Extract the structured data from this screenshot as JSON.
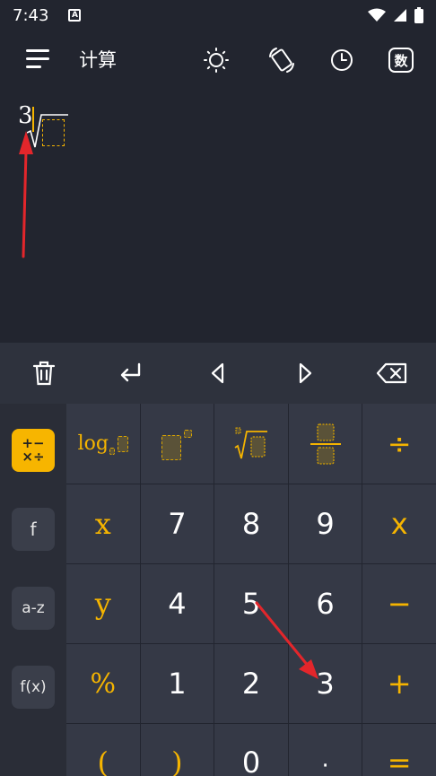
{
  "status_bar": {
    "time": "7:43",
    "notification_icon": "a-notification-icon"
  },
  "app_bar": {
    "title": "计算",
    "num_button_label": "数"
  },
  "display": {
    "root_index": "3",
    "expression": "cube root with empty radicand placeholder"
  },
  "edit_toolbar": [
    "delete-icon",
    "enter-icon",
    "cursor-left-icon",
    "cursor-right-icon",
    "backspace-icon"
  ],
  "side_modes": [
    {
      "label": "+−\n×÷",
      "active": true
    },
    {
      "label": "f",
      "active": false
    },
    {
      "label": "a-z",
      "active": false
    },
    {
      "label": "f(x)",
      "active": false
    }
  ],
  "keys": {
    "row1": {
      "log": "log",
      "divide": "÷"
    },
    "row2": [
      "x",
      "7",
      "8",
      "9",
      "x"
    ],
    "row3": [
      "y",
      "4",
      "5",
      "6",
      "−"
    ],
    "row4": [
      "%",
      "1",
      "2",
      "3",
      "+"
    ],
    "row5": [
      "(",
      ")",
      "0",
      "·",
      "="
    ]
  },
  "colors": {
    "accent": "#f5b400",
    "background": "#22252f",
    "key": "#353946",
    "arrow": "#e3262b"
  }
}
